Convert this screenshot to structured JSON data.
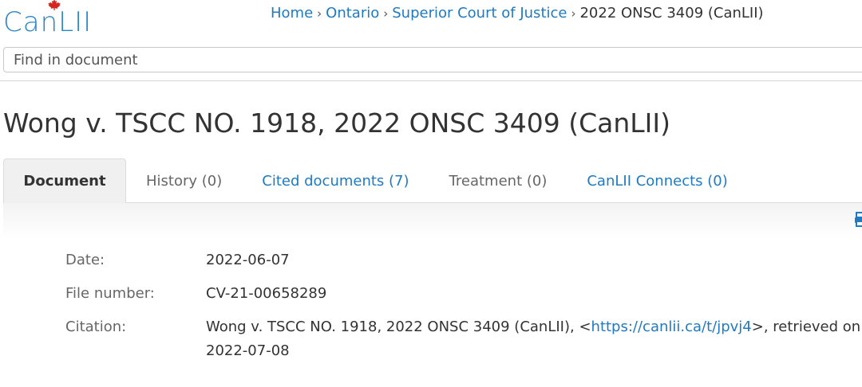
{
  "brand": {
    "logo_text": "CanLII",
    "leaf_color": "#d7261e",
    "accent_color": "#2b86c5"
  },
  "breadcrumb": {
    "items": [
      {
        "label": "Home"
      },
      {
        "label": "Ontario"
      },
      {
        "label": "Superior Court of Justice"
      }
    ],
    "current": "2022 ONSC 3409 (CanLII)",
    "separator": "›"
  },
  "search": {
    "placeholder": "Find in document",
    "value": ""
  },
  "document": {
    "title": "Wong v. TSCC NO. 1918, 2022 ONSC 3409 (CanLII)"
  },
  "tabs": [
    {
      "label": "Document",
      "active": true
    },
    {
      "label": "History (0)"
    },
    {
      "label": "Cited documents (7)"
    },
    {
      "label": "Treatment (0)"
    },
    {
      "label": "CanLII Connects (0)"
    }
  ],
  "toolbar": {
    "print_icon": "print-icon"
  },
  "metadata": {
    "date_label": "Date:",
    "date_value": "2022-06-07",
    "file_number_label": "File number:",
    "file_number_value": "CV-21-00658289",
    "citation_label": "Citation:",
    "citation_prefix": "Wong v. TSCC NO. 1918, 2022 ONSC 3409 (CanLII), <",
    "citation_link": "https://canlii.ca/t/jpvj4",
    "citation_suffix": ">, retrieved on 2022-07-08"
  },
  "colors": {
    "link": "#1f7ac0",
    "text": "#333333",
    "muted": "#666666"
  }
}
